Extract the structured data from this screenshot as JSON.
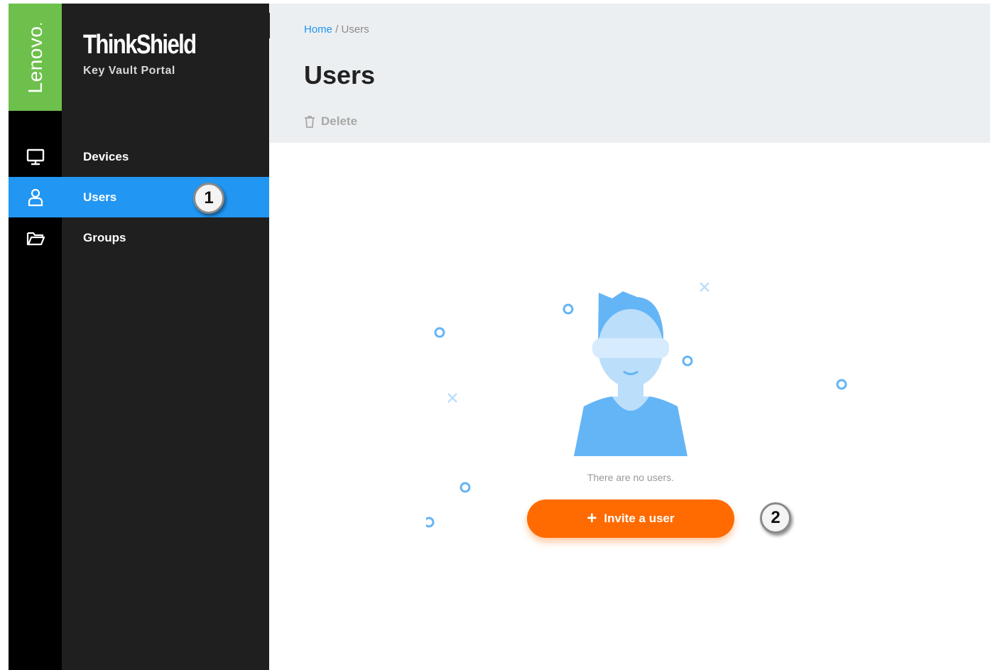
{
  "brand": {
    "company": "Lenovo",
    "product": "ThinkShield",
    "subtitle": "Key Vault Portal"
  },
  "sidebar": {
    "items": [
      {
        "label": "Devices",
        "icon": "monitor-icon",
        "active": false
      },
      {
        "label": "Users",
        "icon": "user-icon",
        "active": true
      },
      {
        "label": "Groups",
        "icon": "folder-open-icon",
        "active": false
      }
    ],
    "collapse_icon": "chevron-left-icon"
  },
  "header": {
    "breadcrumb": {
      "home": "Home",
      "separator": "/",
      "current": "Users"
    },
    "title": "Users",
    "delete_label": "Delete"
  },
  "empty_state": {
    "message": "There are no users.",
    "invite_label": "Invite a user"
  },
  "callouts": {
    "one": "1",
    "two": "2"
  },
  "colors": {
    "accent_blue": "#2196f3",
    "brand_green": "#6dc04b",
    "invite_orange": "#ff6b00",
    "nav_dark": "#1f1f1f"
  }
}
